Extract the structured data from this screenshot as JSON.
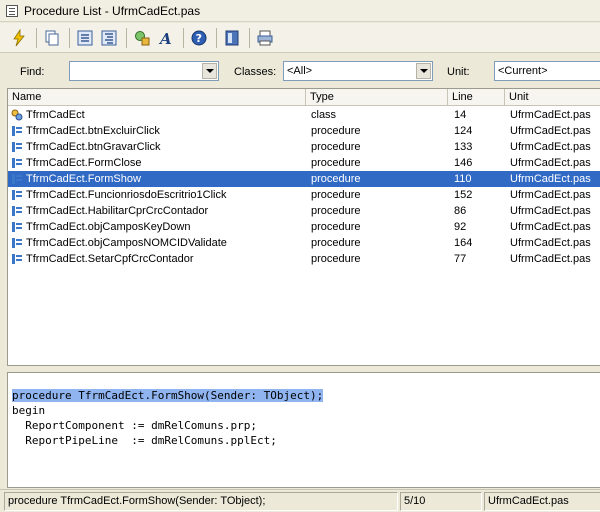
{
  "window": {
    "title": "Procedure List - UfrmCadEct.pas"
  },
  "toolbar": {
    "buttons": [
      "goto-icon",
      "copy-icon",
      "sort-by-name-icon",
      "sort-by-location-icon",
      "search-start-icon",
      "font-icon",
      "help-icon",
      "sync-icon",
      "print-icon"
    ]
  },
  "filters": {
    "find_label": "Find:",
    "find_value": "",
    "classes_label": "Classes:",
    "classes_value": "<All>",
    "unit_label": "Unit:",
    "unit_value": "<Current>"
  },
  "list": {
    "columns": [
      "Name",
      "Type",
      "Line",
      "Unit"
    ],
    "rows": [
      {
        "name": "TfrmCadEct",
        "type": "class",
        "line": "14",
        "unit": "UfrmCadEct.pas",
        "icon": "class-icon",
        "selected": false
      },
      {
        "name": "TfrmCadEct.btnExcluirClick",
        "type": "procedure",
        "line": "124",
        "unit": "UfrmCadEct.pas",
        "icon": "procedure-icon",
        "selected": false
      },
      {
        "name": "TfrmCadEct.btnGravarClick",
        "type": "procedure",
        "line": "133",
        "unit": "UfrmCadEct.pas",
        "icon": "procedure-icon",
        "selected": false
      },
      {
        "name": "TfrmCadEct.FormClose",
        "type": "procedure",
        "line": "146",
        "unit": "UfrmCadEct.pas",
        "icon": "procedure-icon",
        "selected": false
      },
      {
        "name": "TfrmCadEct.FormShow",
        "type": "procedure",
        "line": "110",
        "unit": "UfrmCadEct.pas",
        "icon": "procedure-icon",
        "selected": true
      },
      {
        "name": "TfrmCadEct.FuncionriosdoEscritrio1Click",
        "type": "procedure",
        "line": "152",
        "unit": "UfrmCadEct.pas",
        "icon": "procedure-icon",
        "selected": false
      },
      {
        "name": "TfrmCadEct.HabilitarCprCrcContador",
        "type": "procedure",
        "line": "86",
        "unit": "UfrmCadEct.pas",
        "icon": "procedure-icon",
        "selected": false
      },
      {
        "name": "TfrmCadEct.objCamposKeyDown",
        "type": "procedure",
        "line": "92",
        "unit": "UfrmCadEct.pas",
        "icon": "procedure-icon",
        "selected": false
      },
      {
        "name": "TfrmCadEct.objCamposNOMCIDValidate",
        "type": "procedure",
        "line": "164",
        "unit": "UfrmCadEct.pas",
        "icon": "procedure-icon",
        "selected": false
      },
      {
        "name": "TfrmCadEct.SetarCpfCrcContador",
        "type": "procedure",
        "line": "77",
        "unit": "UfrmCadEct.pas",
        "icon": "procedure-icon",
        "selected": false
      }
    ]
  },
  "code": {
    "lines": [
      "procedure TfrmCadEct.FormShow(Sender: TObject);",
      "begin",
      "  ReportComponent := dmRelComuns.prp;",
      "  ReportPipeLine  := dmRelComuns.pplEct;"
    ]
  },
  "status": {
    "declaration": "procedure TfrmCadEct.FormShow(Sender: TObject);",
    "position": "5/10",
    "unit": "UfrmCadEct.pas"
  },
  "colors": {
    "selection": "#316ac5",
    "code_highlight": "#8fb4ef"
  }
}
